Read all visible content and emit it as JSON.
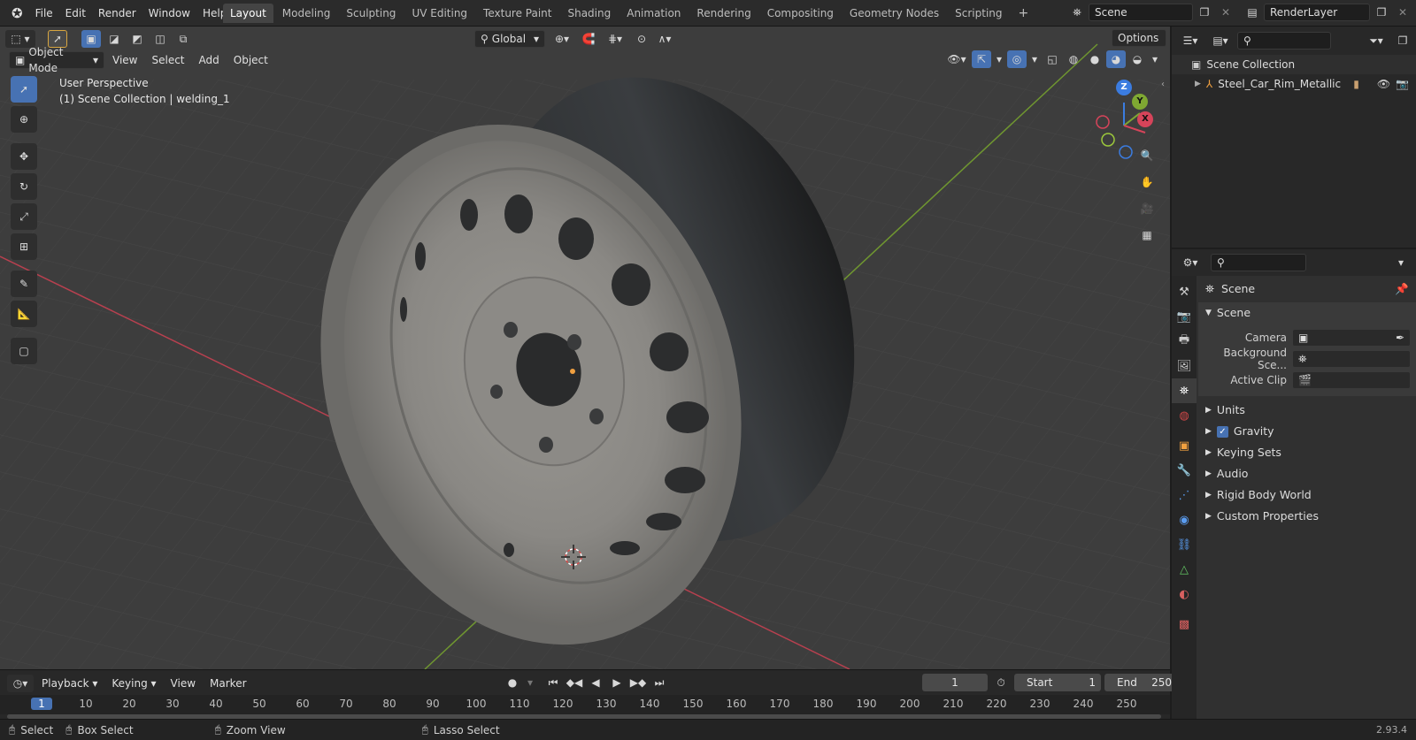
{
  "app": {
    "version": "2.93.4"
  },
  "menu": {
    "items": [
      "File",
      "Edit",
      "Render",
      "Window",
      "Help"
    ]
  },
  "workspaces": {
    "tabs": [
      "Layout",
      "Modeling",
      "Sculpting",
      "UV Editing",
      "Texture Paint",
      "Shading",
      "Animation",
      "Rendering",
      "Compositing",
      "Geometry Nodes",
      "Scripting"
    ],
    "add": "+"
  },
  "scene": {
    "name": "Scene",
    "view_layer": "RenderLayer"
  },
  "viewport": {
    "transform_orientation": "Global",
    "options_label": "Options",
    "mode": "Object Mode",
    "header_menus": [
      "View",
      "Select",
      "Add",
      "Object"
    ],
    "overlay_text_1": "User Perspective",
    "overlay_text_2": "(1) Scene Collection | welding_1",
    "gizmo_axes": [
      "Z",
      "Y",
      "X"
    ]
  },
  "outliner": {
    "root": "Scene Collection",
    "items": [
      {
        "name": "Steel_Car_Rim_Metallic"
      }
    ]
  },
  "properties": {
    "header_title": "Scene",
    "section_scene": "Scene",
    "fields": [
      {
        "label": "Camera"
      },
      {
        "label": "Background Sce..."
      },
      {
        "label": "Active Clip"
      }
    ],
    "subpanels": [
      {
        "label": "Units"
      },
      {
        "label": "Gravity",
        "checked": true
      },
      {
        "label": "Keying Sets"
      },
      {
        "label": "Audio"
      },
      {
        "label": "Rigid Body World"
      },
      {
        "label": "Custom Properties"
      }
    ]
  },
  "timeline": {
    "menus": [
      "Playback",
      "Keying",
      "View",
      "Marker"
    ],
    "current_frame": "1",
    "start_label": "Start",
    "start": "1",
    "end_label": "End",
    "end": "250",
    "ticks": [
      "1",
      "10",
      "20",
      "30",
      "40",
      "50",
      "60",
      "70",
      "80",
      "90",
      "100",
      "110",
      "120",
      "130",
      "140",
      "150",
      "160",
      "170",
      "180",
      "190",
      "200",
      "210",
      "220",
      "230",
      "240",
      "250"
    ]
  },
  "statusbar": {
    "items": [
      "Select",
      "Box Select",
      "Zoom View",
      "Lasso Select"
    ]
  },
  "colors": {
    "accent": "#4772b3",
    "x_axis": "#d6445a",
    "y_axis": "#7fa832",
    "z_axis": "#3b7ce0"
  }
}
